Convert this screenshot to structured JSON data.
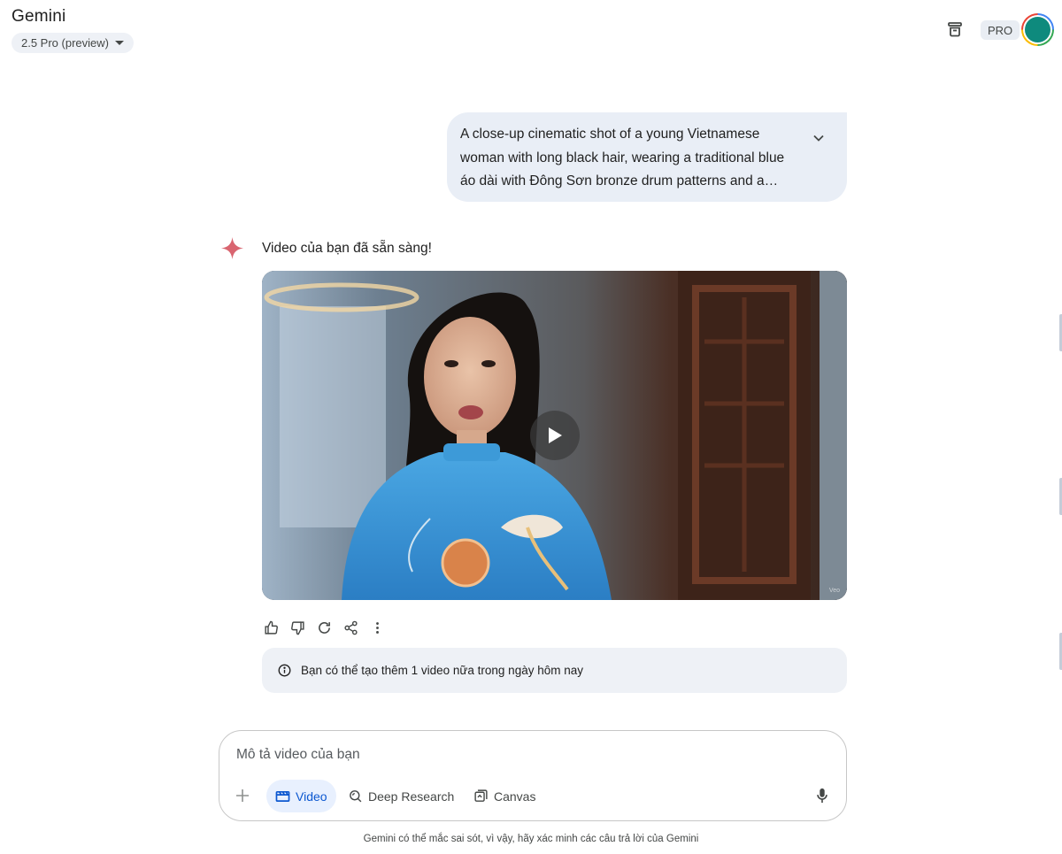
{
  "header": {
    "app_title": "Gemini",
    "model_label": "2.5 Pro (preview)",
    "badge": "PRO",
    "icons": {
      "temporary_chat": "temporary-chat-icon",
      "model_caret": "caret-down-icon"
    }
  },
  "conversation": {
    "user_prompt": "A close-up cinematic shot of a young Vietnamese woman with long black hair, wearing a traditional blue áo dài with Đông Sơn bronze drum patterns and a golden-…",
    "response_text": "Video của bạn đã sẵn sàng!",
    "video": {
      "watermark": "Veo",
      "play_icon": "play-icon"
    },
    "actions": [
      "thumb-up-icon",
      "thumb-down-icon",
      "refresh-icon",
      "share-icon",
      "more-vert-icon"
    ],
    "notice": "Bạn có thể tạo thêm 1 video nữa trong ngày hôm nay"
  },
  "composer": {
    "placeholder": "Mô tả video của bạn",
    "chips": {
      "video": "Video",
      "deep_research": "Deep Research",
      "canvas": "Canvas"
    }
  },
  "footer": {
    "disclaimer": "Gemini có thể mắc sai sót, vì vậy, hãy xác minh các câu trả lời của Gemini"
  },
  "colors": {
    "accent": "#0b57d0",
    "bubble": "#e9eef6",
    "spark": "#d96570",
    "avatar": "#0e8a7d"
  }
}
